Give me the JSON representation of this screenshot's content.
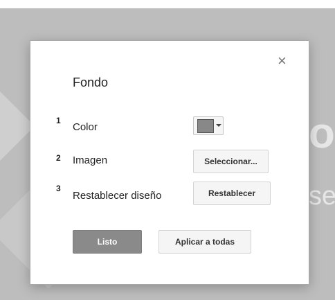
{
  "dialog": {
    "close_icon": "×",
    "title": "Fondo",
    "rows": [
      {
        "number": "1",
        "label": "Color"
      },
      {
        "number": "2",
        "label": "Imagen",
        "button": "Seleccionar..."
      },
      {
        "number": "3",
        "label": "Restablecer diseño",
        "button": "Restablecer"
      }
    ],
    "color_picker": {
      "selected_color": "#888888"
    },
    "done_button": "Listo",
    "apply_all_button": "Aplicar a todas"
  }
}
